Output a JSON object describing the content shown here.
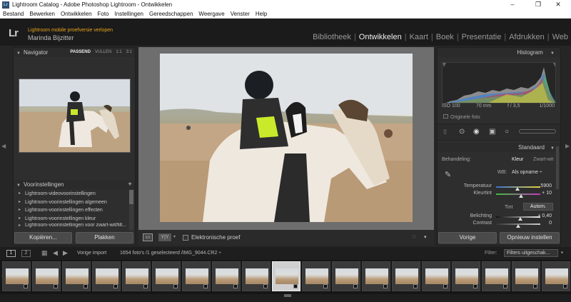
{
  "window": {
    "title": "Lightroom Catalog - Adobe Photoshop Lightroom - Ontwikkelen",
    "app_icon": "Lr",
    "controls": [
      "–",
      "❐",
      "✕"
    ]
  },
  "menu": [
    "Bestand",
    "Bewerken",
    "Ontwikkelen",
    "Foto",
    "Instellingen",
    "Gereedschappen",
    "Weergave",
    "Venster",
    "Help"
  ],
  "identity": {
    "logo": "Lr",
    "notice": "Lightroom mobile proefversie verlopen",
    "user": "Marinda Bijzitter"
  },
  "modules": [
    {
      "label": "Bibliotheek",
      "active": false
    },
    {
      "label": "Ontwikkelen",
      "active": true
    },
    {
      "label": "Kaart",
      "active": false
    },
    {
      "label": "Boek",
      "active": false
    },
    {
      "label": "Presentatie",
      "active": false
    },
    {
      "label": "Afdrukken",
      "active": false
    },
    {
      "label": "Web",
      "active": false
    }
  ],
  "navigator": {
    "title": "Navigator",
    "options": [
      "PASSEND",
      "VULLEN",
      "1:1",
      "3:1"
    ],
    "selected_option": "PASSEND"
  },
  "presets": {
    "title": "Voorinstellingen",
    "add": "+",
    "items": [
      "Lightroom-videovoorinstellingen",
      "Lightroom-voorinstellingen algemeen",
      "Lightroom-voorinstellingen effecten",
      "Lightroom-voorinstellingen kleur",
      "Lightroom-voorinstellingen voor zwart-wit/filt..."
    ]
  },
  "left_buttons": {
    "copy": "Kopiëren...",
    "paste": "Plakken"
  },
  "toolbar": {
    "view_icon": "▭",
    "yy": "Y|Y",
    "soft_proof_label": "Elektronische proef",
    "soft_proof_checked": false
  },
  "histogram": {
    "title": "Histogram",
    "exif": {
      "iso": "ISO 100",
      "focal": "70 mm",
      "aperture": "f / 3,5",
      "shutter": "1/1000"
    },
    "original": "Originele foto"
  },
  "standard": {
    "title": "Standaard",
    "treatment_label": "Behandeling:",
    "treatment_options": [
      "Kleur",
      "Zwart-wit"
    ],
    "treatment_selected": "Kleur",
    "wb_label": "WB:",
    "wb_value": "Als opname ÷",
    "sliders": [
      {
        "label": "Temperatuur",
        "value": "5900",
        "pos": 0.48,
        "kind": "temp"
      },
      {
        "label": "Kleurtint",
        "value": "+ 10",
        "pos": 0.56,
        "kind": "tint"
      },
      {
        "label": "Belichting",
        "value": "+ 0,40",
        "pos": 0.55,
        "kind": "gray"
      },
      {
        "label": "Contrast",
        "value": "0",
        "pos": 0.5,
        "kind": "gray"
      }
    ],
    "tone_label": "Tint",
    "auto_label": "Autom."
  },
  "right_buttons": {
    "prev": "Vorige",
    "reset": "Opnieuw instellen"
  },
  "filmstrip": {
    "screens": [
      "1",
      "2"
    ],
    "source": "Vorige import",
    "info": "1654 foto's /1 geselecteerd /IMG_9044.CR2 ÷",
    "filter_label": "Filter:",
    "filter_value": "Filters uitgeschak...",
    "thumb_count": 19,
    "selected_index": 9
  }
}
